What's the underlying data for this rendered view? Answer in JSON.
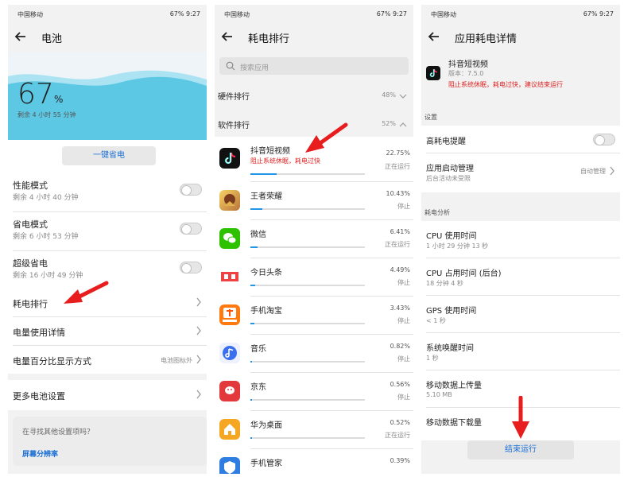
{
  "status": {
    "carrier": "中国移动",
    "battery": "67%",
    "time": "9:27"
  },
  "p1": {
    "title": "电池",
    "percent": "67",
    "percent_unit": "%",
    "remaining": "剩余 4 小时 55 分钟",
    "save_button": "一键省电",
    "modes": [
      {
        "title": "性能模式",
        "sub": "剩余 4 小时 40 分钟"
      },
      {
        "title": "省电模式",
        "sub": "剩余 6 小时 53 分钟"
      },
      {
        "title": "超级省电",
        "sub": "剩余 16 小时 49 分钟"
      }
    ],
    "rank": "耗电排行",
    "usage": "电量使用详情",
    "pct_display": "电量百分比显示方式",
    "pct_display_value": "电池图标外",
    "more": "更多电池设置",
    "hint": "在寻找其他设置项吗？",
    "hint_link": "屏幕分辨率",
    "colors": {
      "accent": "#1a6fd6",
      "wave": "#5cc8e4"
    }
  },
  "p2": {
    "title": "耗电排行",
    "search_placeholder": "搜索应用",
    "hardware": {
      "label": "硬件排行",
      "value": "48%"
    },
    "software": {
      "label": "软件排行",
      "value": "52%"
    },
    "apps": [
      {
        "name": "抖音短视频",
        "pct": "22.75%",
        "status": "正在运行",
        "warn": "阻止系统休眠，耗电过快",
        "fill": 0.2275,
        "icon": "douyin-icon",
        "color": "#111111"
      },
      {
        "name": "王者荣耀",
        "pct": "10.43%",
        "status": "停止",
        "warn": "",
        "fill": 0.1043,
        "icon": "honor-of-kings-icon",
        "color": "#d9a53a"
      },
      {
        "name": "微信",
        "pct": "6.41%",
        "status": "正在运行",
        "warn": "",
        "fill": 0.0641,
        "icon": "wechat-icon",
        "color": "#2dc100"
      },
      {
        "name": "今日头条",
        "pct": "4.49%",
        "status": "停止",
        "warn": "",
        "fill": 0.0449,
        "icon": "toutiao-icon",
        "color": "#f2f2f2"
      },
      {
        "name": "手机淘宝",
        "pct": "3.43%",
        "status": "停止",
        "warn": "",
        "fill": 0.0343,
        "icon": "taobao-icon",
        "color": "#ff7a0f"
      },
      {
        "name": "音乐",
        "pct": "0.82%",
        "status": "停止",
        "warn": "",
        "fill": 0.0082,
        "icon": "music-icon",
        "color": "#e9eefc"
      },
      {
        "name": "京东",
        "pct": "0.56%",
        "status": "停止",
        "warn": "",
        "fill": 0.0056,
        "icon": "jd-icon",
        "color": "#e4393c"
      },
      {
        "name": "华为桌面",
        "pct": "0.52%",
        "status": "正在运行",
        "warn": "",
        "fill": 0.0052,
        "icon": "huawei-launcher-icon",
        "color": "#f5a623"
      },
      {
        "name": "手机管家",
        "pct": "0.39%",
        "status": "",
        "warn": "",
        "fill": 0.0039,
        "icon": "phone-manager-icon",
        "color": "#2f7de1"
      }
    ]
  },
  "p3": {
    "title": "应用耗电详情",
    "app_name": "抖音短视频",
    "version": "版本：7.5.0",
    "warn": "阻止系统休眠，耗电过快，建议结束运行",
    "settings_header": "设置",
    "alert": "高耗电提醒",
    "launch": "应用启动管理",
    "launch_sub": "后台活动未受限",
    "launch_value": "自动管理",
    "analysis_header": "耗电分析",
    "metrics": [
      {
        "title": "CPU 使用时间",
        "value": "1 小时 29 分钟 13 秒"
      },
      {
        "title": "CPU 占用时间 (后台)",
        "value": "18 分钟 4 秒"
      },
      {
        "title": "GPS 使用时间",
        "value": "< 1 秒"
      },
      {
        "title": "系统唤醒时间",
        "value": "1 秒"
      },
      {
        "title": "移动数据上传量",
        "value": "5.10 MB"
      },
      {
        "title": "移动数据下载量",
        "value": ""
      }
    ],
    "end_button": "结束运行"
  }
}
